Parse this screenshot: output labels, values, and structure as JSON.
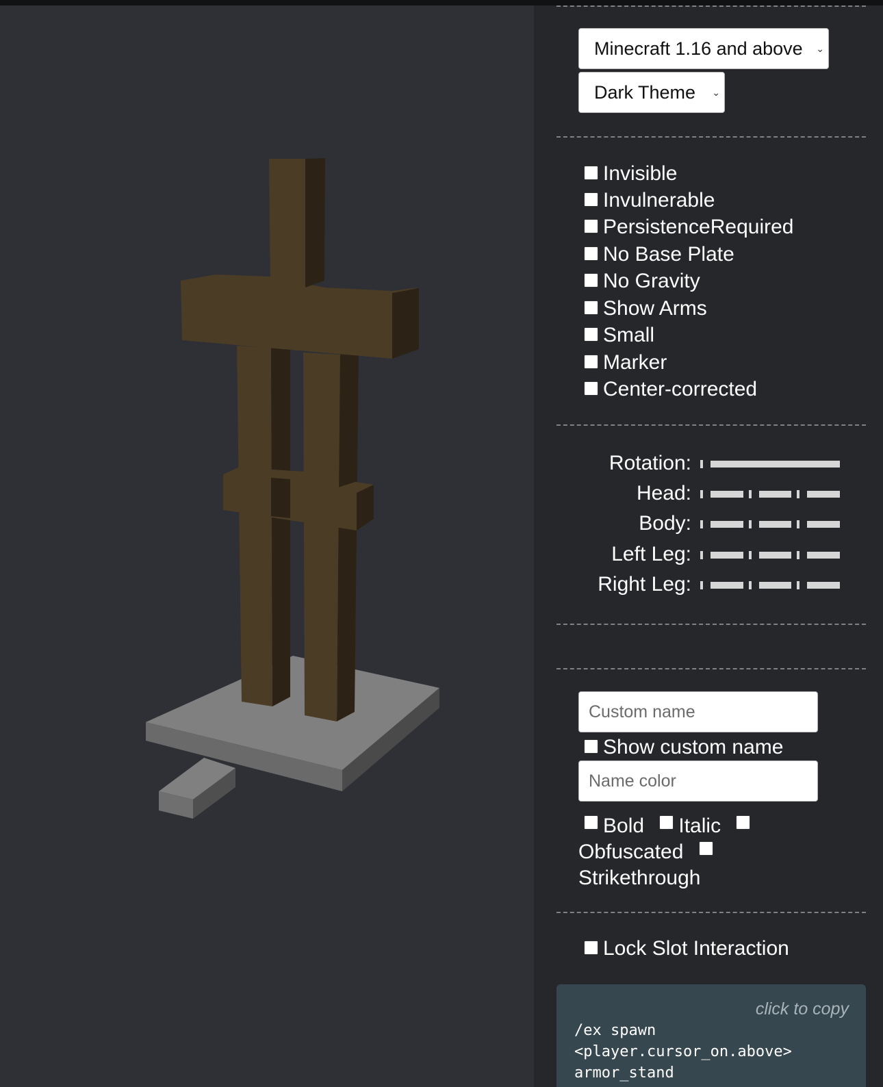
{
  "settings": {
    "version_select": "Minecraft 1.16 and above",
    "theme_select": "Dark Theme"
  },
  "flags": [
    {
      "label": "Invisible",
      "checked": false
    },
    {
      "label": "Invulnerable",
      "checked": false
    },
    {
      "label": "PersistenceRequired",
      "checked": false
    },
    {
      "label": "No Base Plate",
      "checked": false
    },
    {
      "label": "No Gravity",
      "checked": false
    },
    {
      "label": "Show Arms",
      "checked": false
    },
    {
      "label": "Small",
      "checked": false
    },
    {
      "label": "Marker",
      "checked": false
    },
    {
      "label": "Center-corrected",
      "checked": false
    }
  ],
  "rotations": {
    "rotation_label": "Rotation:",
    "head_label": "Head:",
    "body_label": "Body:",
    "left_leg_label": "Left Leg:",
    "right_leg_label": "Right Leg:"
  },
  "name": {
    "custom_name_placeholder": "Custom name",
    "show_custom_name_label": "Show custom name",
    "name_color_placeholder": "Name color",
    "bold_label": "Bold",
    "italic_label": "Italic",
    "obfuscated_label": "Obfuscated",
    "strikethrough_label": "Strikethrough"
  },
  "lock": {
    "label": "Lock Slot Interaction"
  },
  "command": {
    "copy_hint": "click to copy",
    "text": "/ex spawn\n<player.cursor_on.above>\narmor_stand"
  },
  "colors": {
    "viewport_bg": "#2e3035",
    "panel_bg": "#25272a",
    "wood_front": "#4b3c26",
    "wood_side": "#2c2316",
    "plate_top": "#808080",
    "plate_side": "#5f5f5f",
    "command_bg": "#37474f"
  }
}
